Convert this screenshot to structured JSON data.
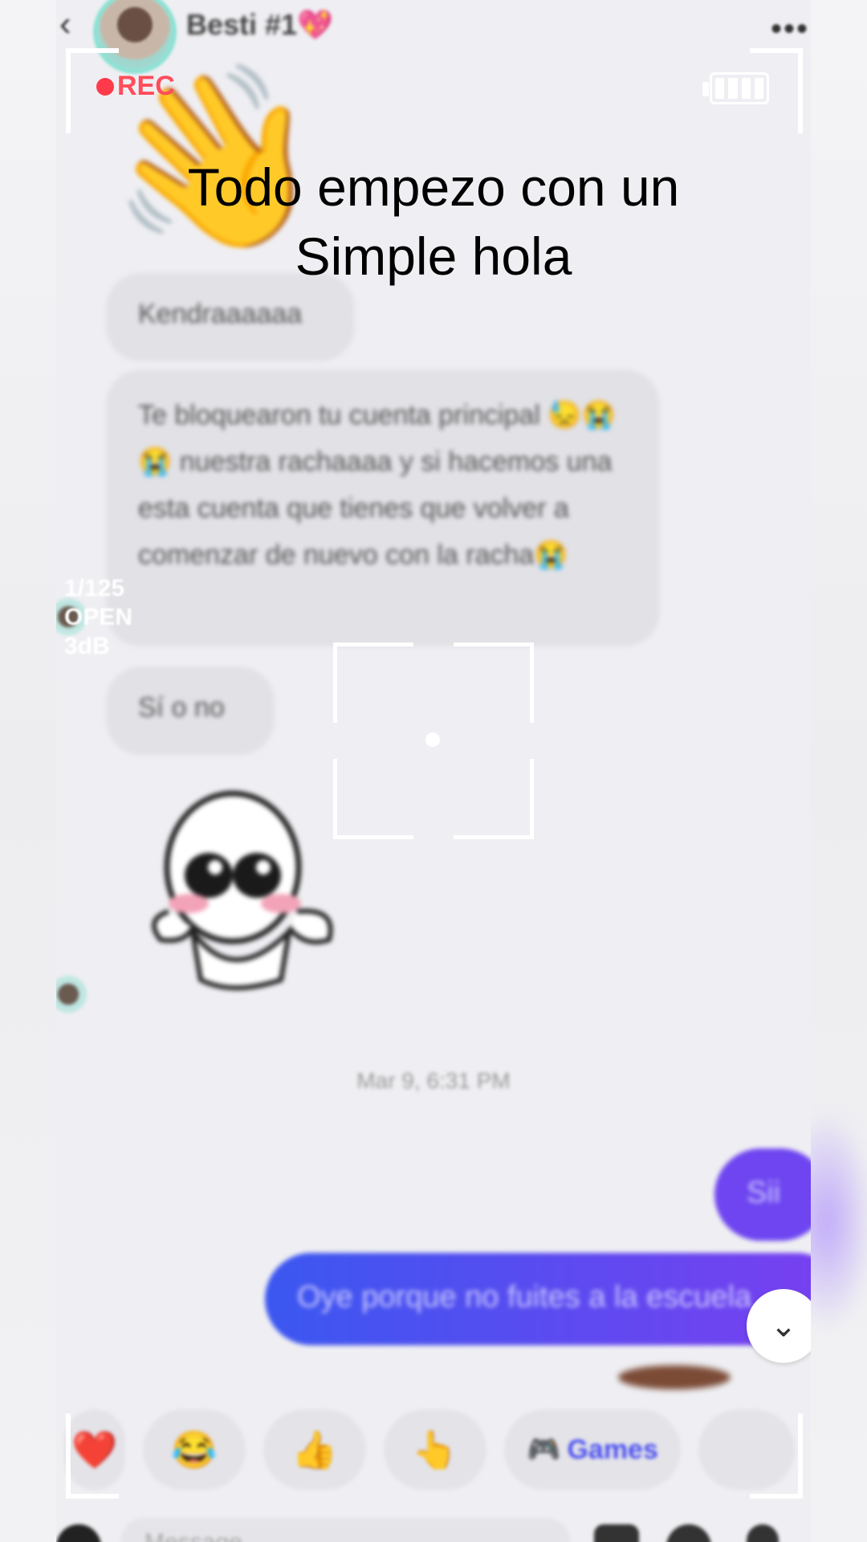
{
  "header": {
    "contact_name": "Besti #1💖",
    "back_icon": "chevron-left-icon",
    "more_icon": "ellipsis-icon"
  },
  "camera_overlay": {
    "rec_label": "REC",
    "side_info": [
      "1/125",
      "OPEN",
      "3dB"
    ]
  },
  "caption": {
    "line1": "Todo empezo con un",
    "line2": "Simple hola"
  },
  "messages": {
    "incoming": [
      "Kendraaaaaa",
      "Te bloquearon tu cuenta principal 😓😭😭 nuestra rachaaaa y si hacemos una esta cuenta que tienes que volver a comenzar de nuevo con la racha😭",
      "Sí o no"
    ],
    "timestamp": "Mar 9, 6:31 PM",
    "outgoing": [
      "Sii",
      "Oye porque no fuites a la escuela"
    ]
  },
  "reactions": {
    "heart": "❤️",
    "laugh": "😂",
    "thumbs": "👍",
    "point": "👆",
    "games_label": "Games"
  },
  "composer": {
    "placeholder": "Message"
  },
  "colors": {
    "rec": "#ff3b4b",
    "outgoing_start": "#3b57f0",
    "outgoing_end": "#7a3ff0"
  }
}
